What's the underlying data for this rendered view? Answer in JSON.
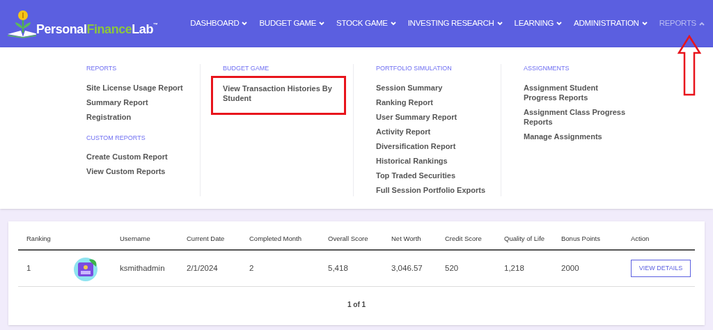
{
  "logo": {
    "parts": [
      {
        "text": "Personal",
        "kind": "plain"
      },
      {
        "text": "Finance",
        "kind": "accent"
      },
      {
        "text": "Lab",
        "kind": "plain"
      }
    ],
    "mark": "™"
  },
  "nav": [
    {
      "label": "DASHBOARD",
      "selected": false,
      "expanded": false,
      "pointed": false
    },
    {
      "label": "BUDGET GAME",
      "selected": false,
      "expanded": false,
      "pointed": false
    },
    {
      "label": "STOCK GAME",
      "selected": false,
      "expanded": false,
      "pointed": false
    },
    {
      "label": "INVESTING RESEARCH",
      "selected": false,
      "expanded": false,
      "pointed": false
    },
    {
      "label": "LEARNING",
      "selected": false,
      "expanded": false,
      "pointed": false
    },
    {
      "label": "ADMINISTRATION",
      "selected": false,
      "expanded": false,
      "pointed": false
    },
    {
      "label": "REPORTS",
      "selected": true,
      "expanded": true,
      "pointed": true
    }
  ],
  "menu": [
    {
      "groups": [
        {
          "heading": "REPORTS",
          "items": [
            {
              "label": "Site License Usage Report",
              "highlighted": false
            },
            {
              "label": "Summary Report",
              "highlighted": false
            },
            {
              "label": "Registration",
              "highlighted": false
            }
          ]
        },
        {
          "heading": "CUSTOM REPORTS",
          "items": [
            {
              "label": "Create Custom Report",
              "highlighted": false
            },
            {
              "label": "View Custom Reports",
              "highlighted": false
            }
          ]
        }
      ]
    },
    {
      "groups": [
        {
          "heading": "BUDGET GAME",
          "items": [
            {
              "label": "View Transaction Histories By Student",
              "highlighted": true
            }
          ]
        }
      ]
    },
    {
      "groups": [
        {
          "heading": "PORTFOLIO SIMULATION",
          "items": [
            {
              "label": "Session Summary",
              "highlighted": false
            },
            {
              "label": "Ranking Report",
              "highlighted": false
            },
            {
              "label": "User Summary Report",
              "highlighted": false
            },
            {
              "label": "Activity Report",
              "highlighted": false
            },
            {
              "label": "Diversification Report",
              "highlighted": false
            },
            {
              "label": "Historical Rankings",
              "highlighted": false
            },
            {
              "label": "Top Traded Securities",
              "highlighted": false
            },
            {
              "label": "Full Session Portfolio Exports",
              "highlighted": false
            }
          ]
        }
      ]
    },
    {
      "groups": [
        {
          "heading": "ASSIGNMENTS",
          "items": [
            {
              "label": "Assignment Student Progress Reports",
              "highlighted": false
            },
            {
              "label": "Assignment Class Progress Reports",
              "highlighted": false
            },
            {
              "label": "Manage Assignments",
              "highlighted": false
            }
          ]
        }
      ]
    }
  ],
  "table": {
    "columns": [
      "Ranking",
      "",
      "Username",
      "Current Date",
      "Completed Month",
      "Overall Score",
      "Net Worth",
      "Credit Score",
      "Quality of Life",
      "Bonus Points",
      "Action"
    ],
    "rows": [
      {
        "ranking": "1",
        "username": "ksmithadmin",
        "current_date": "2/1/2024",
        "completed_month": "2",
        "overall_score": "5,418",
        "net_worth": "3,046.57",
        "credit_score": "520",
        "quality_of_life": "1,218",
        "bonus_points": "2000",
        "action": "VIEW DETAILS"
      }
    ]
  },
  "pagination": "1 of 1"
}
